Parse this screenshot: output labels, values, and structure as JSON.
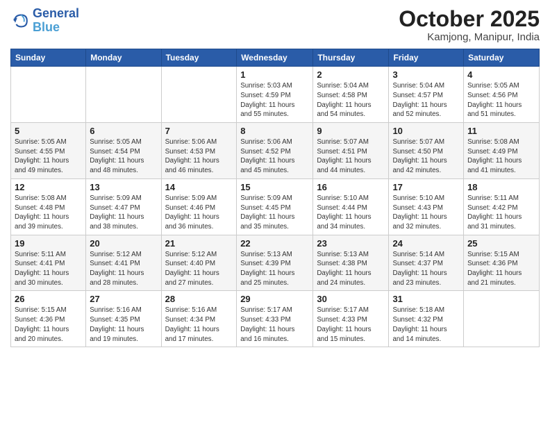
{
  "header": {
    "logo_line1": "General",
    "logo_line2": "Blue",
    "month_title": "October 2025",
    "subtitle": "Kamjong, Manipur, India"
  },
  "days_of_week": [
    "Sunday",
    "Monday",
    "Tuesday",
    "Wednesday",
    "Thursday",
    "Friday",
    "Saturday"
  ],
  "weeks": [
    [
      {
        "day": "",
        "info": ""
      },
      {
        "day": "",
        "info": ""
      },
      {
        "day": "",
        "info": ""
      },
      {
        "day": "1",
        "info": "Sunrise: 5:03 AM\nSunset: 4:59 PM\nDaylight: 11 hours\nand 55 minutes."
      },
      {
        "day": "2",
        "info": "Sunrise: 5:04 AM\nSunset: 4:58 PM\nDaylight: 11 hours\nand 54 minutes."
      },
      {
        "day": "3",
        "info": "Sunrise: 5:04 AM\nSunset: 4:57 PM\nDaylight: 11 hours\nand 52 minutes."
      },
      {
        "day": "4",
        "info": "Sunrise: 5:05 AM\nSunset: 4:56 PM\nDaylight: 11 hours\nand 51 minutes."
      }
    ],
    [
      {
        "day": "5",
        "info": "Sunrise: 5:05 AM\nSunset: 4:55 PM\nDaylight: 11 hours\nand 49 minutes."
      },
      {
        "day": "6",
        "info": "Sunrise: 5:05 AM\nSunset: 4:54 PM\nDaylight: 11 hours\nand 48 minutes."
      },
      {
        "day": "7",
        "info": "Sunrise: 5:06 AM\nSunset: 4:53 PM\nDaylight: 11 hours\nand 46 minutes."
      },
      {
        "day": "8",
        "info": "Sunrise: 5:06 AM\nSunset: 4:52 PM\nDaylight: 11 hours\nand 45 minutes."
      },
      {
        "day": "9",
        "info": "Sunrise: 5:07 AM\nSunset: 4:51 PM\nDaylight: 11 hours\nand 44 minutes."
      },
      {
        "day": "10",
        "info": "Sunrise: 5:07 AM\nSunset: 4:50 PM\nDaylight: 11 hours\nand 42 minutes."
      },
      {
        "day": "11",
        "info": "Sunrise: 5:08 AM\nSunset: 4:49 PM\nDaylight: 11 hours\nand 41 minutes."
      }
    ],
    [
      {
        "day": "12",
        "info": "Sunrise: 5:08 AM\nSunset: 4:48 PM\nDaylight: 11 hours\nand 39 minutes."
      },
      {
        "day": "13",
        "info": "Sunrise: 5:09 AM\nSunset: 4:47 PM\nDaylight: 11 hours\nand 38 minutes."
      },
      {
        "day": "14",
        "info": "Sunrise: 5:09 AM\nSunset: 4:46 PM\nDaylight: 11 hours\nand 36 minutes."
      },
      {
        "day": "15",
        "info": "Sunrise: 5:09 AM\nSunset: 4:45 PM\nDaylight: 11 hours\nand 35 minutes."
      },
      {
        "day": "16",
        "info": "Sunrise: 5:10 AM\nSunset: 4:44 PM\nDaylight: 11 hours\nand 34 minutes."
      },
      {
        "day": "17",
        "info": "Sunrise: 5:10 AM\nSunset: 4:43 PM\nDaylight: 11 hours\nand 32 minutes."
      },
      {
        "day": "18",
        "info": "Sunrise: 5:11 AM\nSunset: 4:42 PM\nDaylight: 11 hours\nand 31 minutes."
      }
    ],
    [
      {
        "day": "19",
        "info": "Sunrise: 5:11 AM\nSunset: 4:41 PM\nDaylight: 11 hours\nand 30 minutes."
      },
      {
        "day": "20",
        "info": "Sunrise: 5:12 AM\nSunset: 4:41 PM\nDaylight: 11 hours\nand 28 minutes."
      },
      {
        "day": "21",
        "info": "Sunrise: 5:12 AM\nSunset: 4:40 PM\nDaylight: 11 hours\nand 27 minutes."
      },
      {
        "day": "22",
        "info": "Sunrise: 5:13 AM\nSunset: 4:39 PM\nDaylight: 11 hours\nand 25 minutes."
      },
      {
        "day": "23",
        "info": "Sunrise: 5:13 AM\nSunset: 4:38 PM\nDaylight: 11 hours\nand 24 minutes."
      },
      {
        "day": "24",
        "info": "Sunrise: 5:14 AM\nSunset: 4:37 PM\nDaylight: 11 hours\nand 23 minutes."
      },
      {
        "day": "25",
        "info": "Sunrise: 5:15 AM\nSunset: 4:36 PM\nDaylight: 11 hours\nand 21 minutes."
      }
    ],
    [
      {
        "day": "26",
        "info": "Sunrise: 5:15 AM\nSunset: 4:36 PM\nDaylight: 11 hours\nand 20 minutes."
      },
      {
        "day": "27",
        "info": "Sunrise: 5:16 AM\nSunset: 4:35 PM\nDaylight: 11 hours\nand 19 minutes."
      },
      {
        "day": "28",
        "info": "Sunrise: 5:16 AM\nSunset: 4:34 PM\nDaylight: 11 hours\nand 17 minutes."
      },
      {
        "day": "29",
        "info": "Sunrise: 5:17 AM\nSunset: 4:33 PM\nDaylight: 11 hours\nand 16 minutes."
      },
      {
        "day": "30",
        "info": "Sunrise: 5:17 AM\nSunset: 4:33 PM\nDaylight: 11 hours\nand 15 minutes."
      },
      {
        "day": "31",
        "info": "Sunrise: 5:18 AM\nSunset: 4:32 PM\nDaylight: 11 hours\nand 14 minutes."
      },
      {
        "day": "",
        "info": ""
      }
    ]
  ]
}
